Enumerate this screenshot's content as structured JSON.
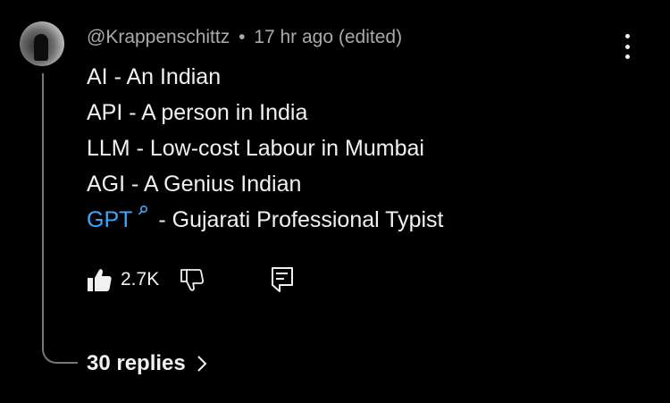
{
  "comment": {
    "author": "@Krappenschittz",
    "separator": "•",
    "time": "17 hr ago (edited)",
    "lines": [
      "AI - An Indian",
      "API - A person in India",
      "LLM - Low-cost Labour in Mumbai",
      "AGI - A Genius Indian"
    ],
    "last_line": {
      "link_text": "GPT",
      "text": "- Gujarati Professional Typist"
    },
    "likes": "2.7K",
    "replies_label": "30 replies"
  },
  "colors": {
    "background": "#000000",
    "text": "#f1f1f1",
    "meta": "#aaaaaa",
    "link": "#3ea6ff"
  },
  "icons": [
    "more-vert-icon",
    "search-icon",
    "thumbs-up-icon",
    "thumbs-down-icon",
    "reply-comment-icon",
    "chevron-right-icon"
  ]
}
